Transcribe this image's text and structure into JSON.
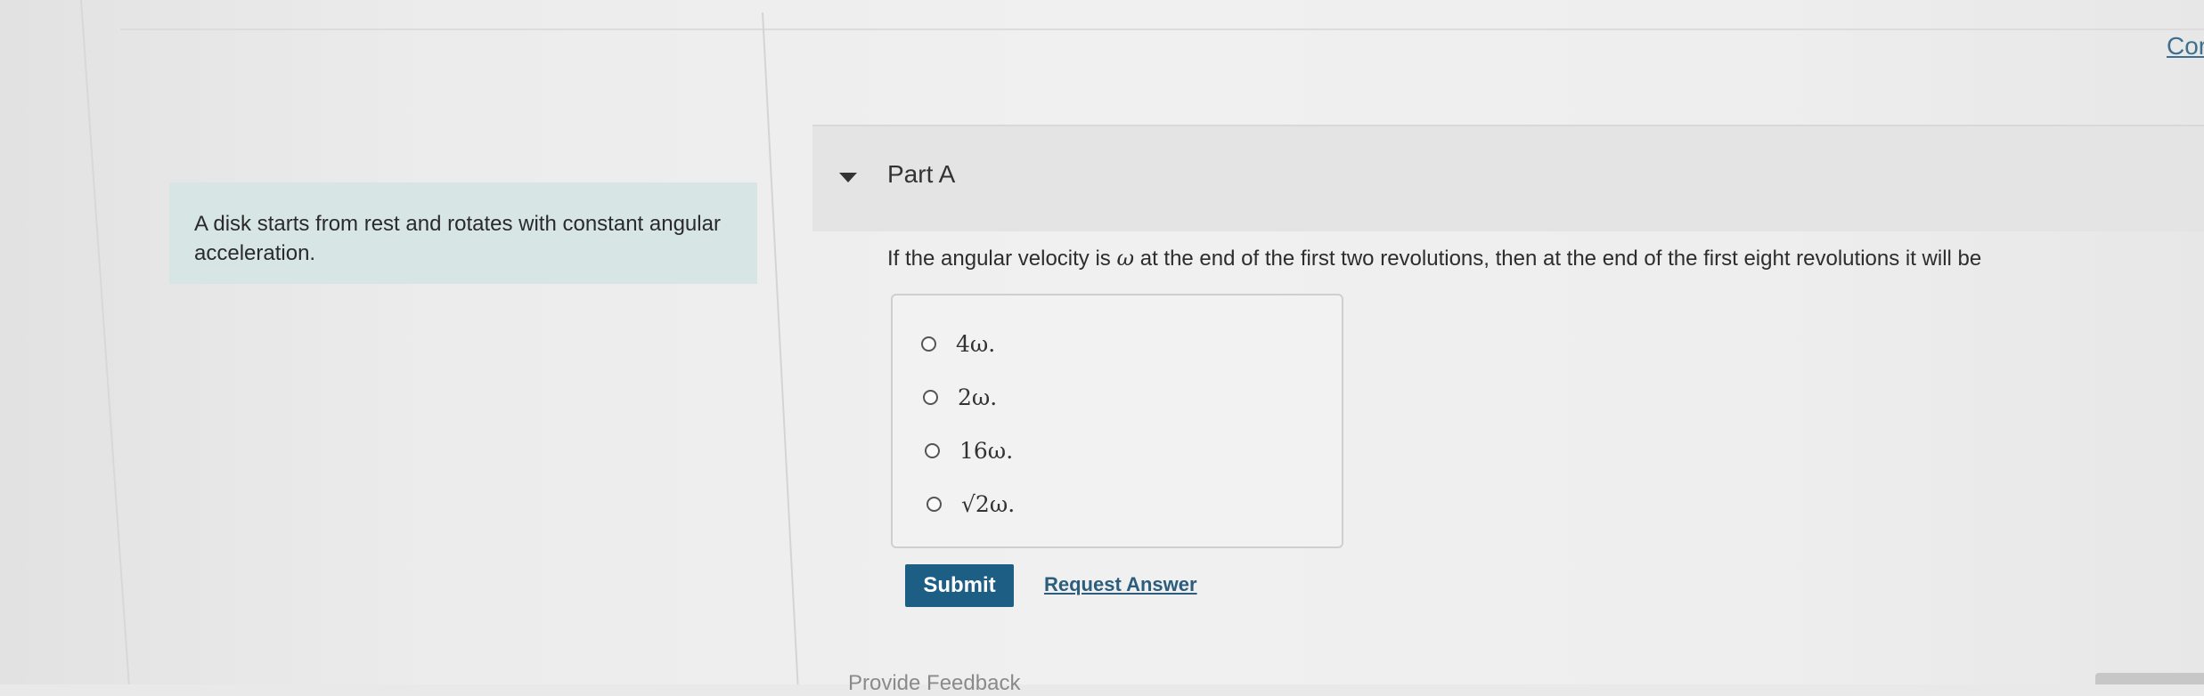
{
  "intro": {
    "text": "A disk starts from rest and rotates with constant angular acceleration."
  },
  "top_right_link": "Cor",
  "part": {
    "title": "Part A"
  },
  "question": {
    "before": "If the angular velocity is ",
    "symbol": "ω",
    "after": " at the end of the first two revolutions, then at the end of the first eight revolutions it will be"
  },
  "options": [
    {
      "label": "4ω."
    },
    {
      "label": "2ω."
    },
    {
      "label": "16ω."
    },
    {
      "label": "√2ω."
    }
  ],
  "actions": {
    "submit_label": "Submit",
    "request_answer_label": "Request Answer"
  },
  "feedback_label": "Provide Feedback"
}
